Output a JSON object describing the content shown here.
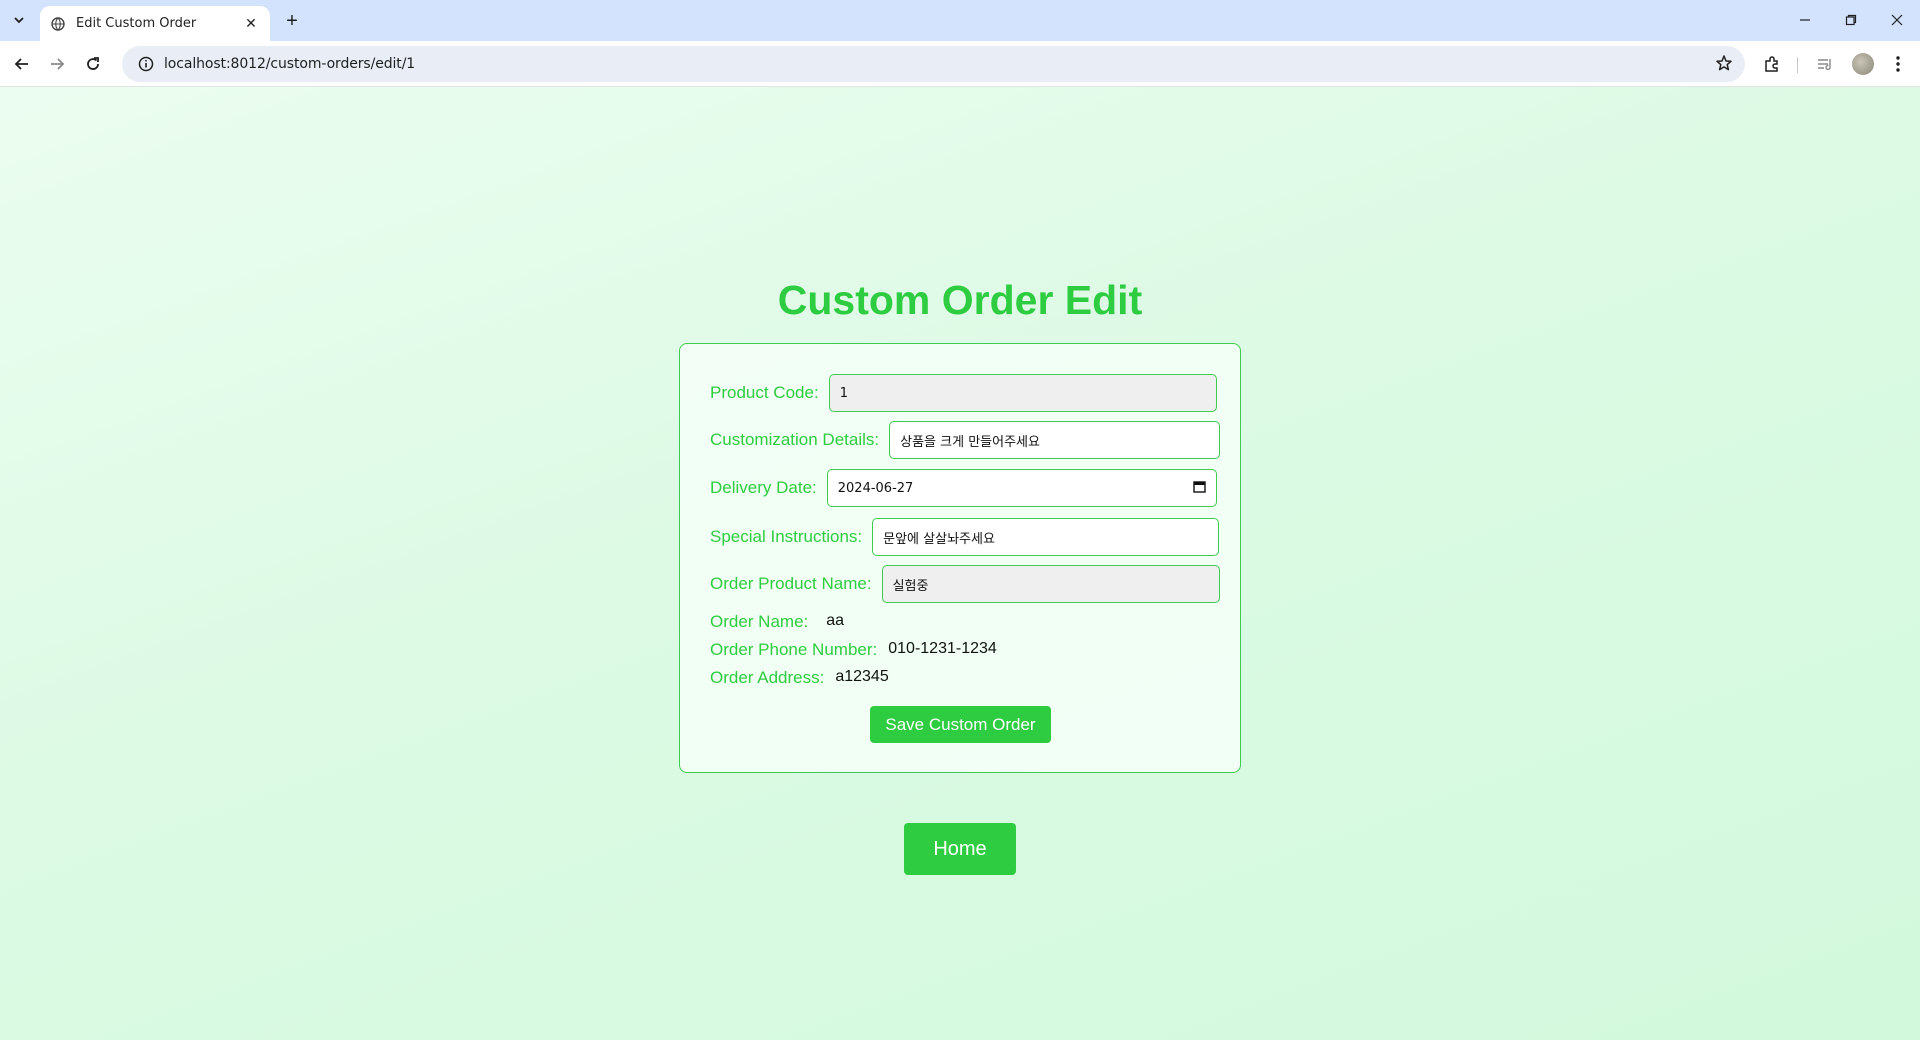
{
  "browser": {
    "tab_title": "Edit Custom Order",
    "url": "localhost:8012/custom-orders/edit/1"
  },
  "page": {
    "heading": "Custom Order Edit",
    "form": {
      "product_code_label": "Product Code:",
      "product_code_value": "1",
      "customization_label": "Customization Details:",
      "customization_value": "상품을 크게 만들어주세요",
      "delivery_label": "Delivery Date:",
      "delivery_value": "2024-06-27",
      "special_label": "Special Instructions:",
      "special_value": "문앞에 살살놔주세요",
      "product_name_label": "Order Product Name:",
      "product_name_value": "실험중",
      "order_name_label": "Order Name:",
      "order_name_value": "aa",
      "phone_label": "Order Phone Number:",
      "phone_value": "010-1231-1234",
      "address_label": "Order Address:",
      "address_value": "a12345",
      "save_label": "Save Custom Order"
    },
    "home_label": "Home"
  },
  "colors": {
    "accent": "#2ecc40",
    "background": "#dcfae4"
  },
  "icons": [
    "tab-search-icon",
    "globe-icon",
    "close-icon",
    "plus-icon",
    "minimize-icon",
    "restore-icon",
    "back-icon",
    "forward-icon",
    "reload-icon",
    "info-icon",
    "star-icon",
    "extensions-icon",
    "reading-list-icon",
    "calendar-icon"
  ]
}
